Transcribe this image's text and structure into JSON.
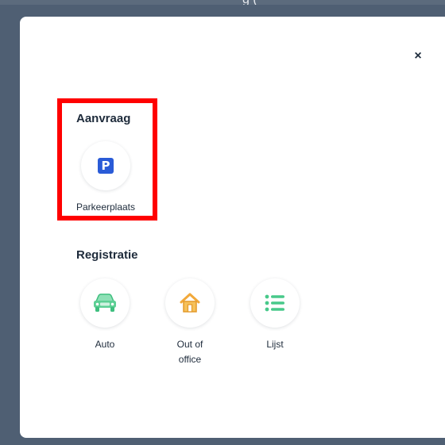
{
  "background_text": "g (",
  "close_label": "×",
  "sections": {
    "request": {
      "title": "Aanvraag",
      "items": [
        {
          "label": "Parkeerplaats",
          "icon": "parking-icon"
        }
      ]
    },
    "registration": {
      "title": "Registratie",
      "items": [
        {
          "label": "Auto",
          "icon": "car-icon"
        },
        {
          "label": "Out of\noffice",
          "icon": "house-icon"
        },
        {
          "label": "Lijst",
          "icon": "list-icon"
        }
      ]
    }
  },
  "colors": {
    "overlay": "#4f5f73",
    "text": "#1e2b3b",
    "parking": "#2a5bd7",
    "car": "#5ccf94",
    "house": "#f2a93b",
    "list": "#48c98a",
    "highlight": "#ff0000"
  }
}
